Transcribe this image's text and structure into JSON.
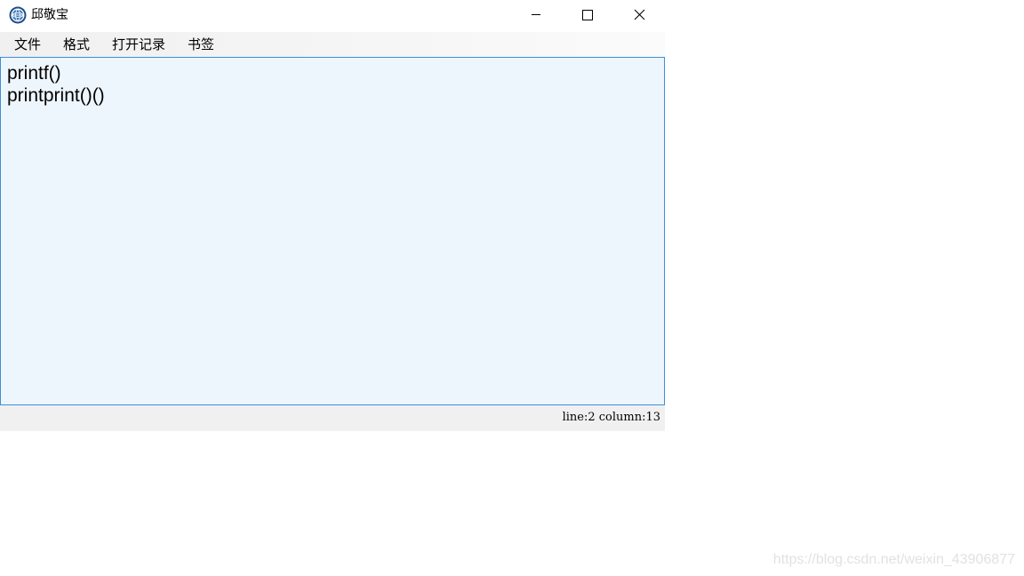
{
  "window": {
    "title": "邱敬宝"
  },
  "menubar": {
    "items": [
      {
        "label": "文件"
      },
      {
        "label": "格式"
      },
      {
        "label": "打开记录"
      },
      {
        "label": "书签"
      }
    ]
  },
  "editor": {
    "lines": [
      "printf()",
      "printprint()()"
    ]
  },
  "statusbar": {
    "cursor_position": "line:2 column:13"
  },
  "watermark": "https://blog.csdn.net/weixin_43906877",
  "colors": {
    "editor_background": "#eef6fd",
    "editor_border": "#3c8fd6",
    "menubar_background": "#f0f0f0",
    "statusbar_background": "#f0f0f0"
  },
  "icons": {
    "app": "globe-logo-icon",
    "minimize": "minimize-icon",
    "maximize": "maximize-icon",
    "close": "close-icon"
  }
}
